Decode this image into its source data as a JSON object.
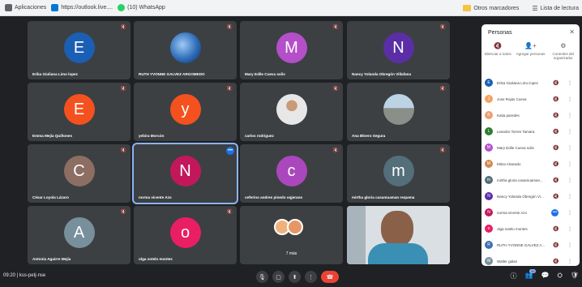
{
  "bookmarks": {
    "items": [
      {
        "label": "Aplicaciones",
        "icon": "apps-icon",
        "color": "#5f6368"
      },
      {
        "label": "https://outlook.live....",
        "icon": "outlook-icon",
        "color": "#0078d4"
      },
      {
        "label": "(10) WhatsApp",
        "icon": "whatsapp-icon",
        "color": "#25d366"
      }
    ],
    "others_label": "Otros marcadores",
    "reading_list_label": "Lista de lectura"
  },
  "tiles": [
    {
      "name": "Erika Giuliana Limo lopez",
      "initial": "E",
      "color": "#1a5fb4",
      "type": "initial"
    },
    {
      "name": "RUTH YVONNE GALVEZ ARGOMEDO",
      "initial": "",
      "color": "#3d6fb0",
      "type": "earth"
    },
    {
      "name": "Mary Edile Cueva solis",
      "initial": "M",
      "color": "#b44fc9",
      "type": "initial"
    },
    {
      "name": "Nancy Yolanda Obregón Villafana",
      "initial": "N",
      "color": "#5b2ea6",
      "type": "initial"
    },
    {
      "name": "Emma Mejía Quiñones",
      "initial": "E",
      "color": "#f4511e",
      "type": "initial"
    },
    {
      "name": "yebira Morcón",
      "initial": "y",
      "color": "#f4511e",
      "type": "initial"
    },
    {
      "name": "carlos rodriguez",
      "initial": "",
      "color": "#6d4c41",
      "type": "man"
    },
    {
      "name": "Ana Blnero Segura",
      "initial": "",
      "color": "#7a8a99",
      "type": "landscape"
    },
    {
      "name": "César Loyola Lázaro",
      "initial": "C",
      "color": "#8d6e63",
      "type": "initial"
    },
    {
      "name": "norma vicente Azo",
      "initial": "N",
      "color": "#c2185b",
      "type": "initial"
    },
    {
      "name": "ceferino andres pinedo oqjerano",
      "initial": "c",
      "color": "#ab47bc",
      "type": "initial"
    },
    {
      "name": "mirtha gloria casamuaman requena",
      "initial": "m",
      "color": "#546e7a",
      "type": "initial"
    },
    {
      "name": "Antonia Aguirre Mejía",
      "initial": "A",
      "color": "#78909c",
      "type": "initial"
    },
    {
      "name": "olga sotelo montes",
      "initial": "o",
      "color": "#e91e63",
      "type": "initial"
    },
    {
      "name": "",
      "initial": "",
      "color": "#3c4043",
      "type": "more"
    },
    {
      "name": "",
      "initial": "",
      "color": "#c7cfd4",
      "type": "video"
    }
  ],
  "more_tile": {
    "count_label": "7 más"
  },
  "panel": {
    "title": "Personas",
    "actions": [
      {
        "label": "Silenciar a todos",
        "icon": "mute-all-icon"
      },
      {
        "label": "Agregar personas",
        "icon": "add-person-icon"
      },
      {
        "label": "Controles del organizador",
        "icon": "host-controls-icon"
      }
    ],
    "participants": [
      {
        "name": "Erika Giuliana Limo lopez",
        "initial": "E",
        "color": "#1a5fb4"
      },
      {
        "name": "Jose Rojas Cueva",
        "initial": "J",
        "color": "#f4a261"
      },
      {
        "name": "Katia paredes",
        "initial": "K",
        "color": "#e9a06f"
      },
      {
        "name": "Leandro Torres Tamara",
        "initial": "L",
        "color": "#2e7d32"
      },
      {
        "name": "Mary Edile Cueva solis",
        "initial": "M",
        "color": "#b44fc9"
      },
      {
        "name": "Mitza Alvarado",
        "initial": "M",
        "color": "#d08a4e"
      },
      {
        "name": "mirtha gloria casamuaman...",
        "initial": "m",
        "color": "#546e7a"
      },
      {
        "name": "Nancy Yolanda Obregón Vi...",
        "initial": "N",
        "color": "#5b2ea6"
      },
      {
        "name": "norma vicente Azo",
        "initial": "N",
        "color": "#c2185b"
      },
      {
        "name": "olga sotelo montes",
        "initial": "o",
        "color": "#e91e63"
      },
      {
        "name": "RUTH YVONNE GALVEZ A...",
        "initial": "R",
        "color": "#3d6fb0"
      },
      {
        "name": "Walter galan",
        "initial": "W",
        "color": "#78909c"
      }
    ]
  },
  "bottom": {
    "meeting_time_and_code": "09:20 | kss-petj-nse",
    "participant_count": "20"
  }
}
